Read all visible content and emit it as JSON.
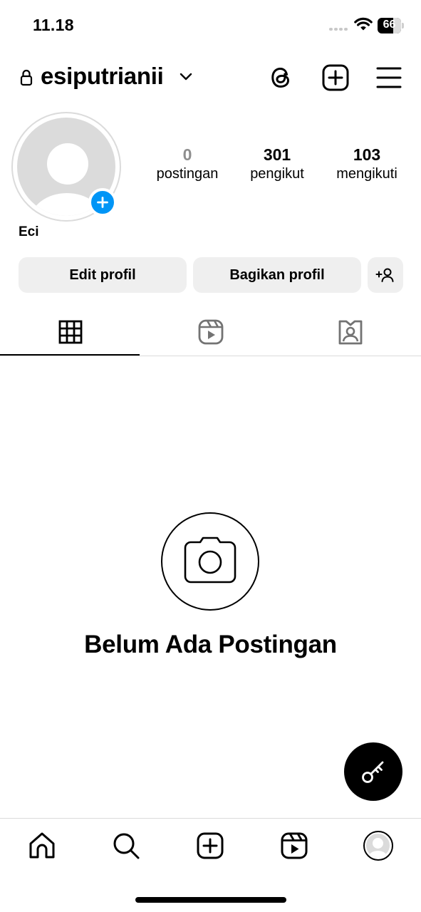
{
  "status_bar": {
    "time": "11.18",
    "battery_level": "66",
    "battery_percent": 66
  },
  "header": {
    "username": "esiputrianii",
    "icons": [
      "lock-icon",
      "chevron-down-icon",
      "threads-icon",
      "create-post-icon",
      "menu-icon"
    ]
  },
  "profile": {
    "display_name": "Eci",
    "stats": [
      {
        "value": "0",
        "label": "postingan"
      },
      {
        "value": "301",
        "label": "pengikut"
      },
      {
        "value": "103",
        "label": "mengikuti"
      }
    ],
    "buttons": {
      "edit": "Edit profil",
      "share": "Bagikan profil"
    }
  },
  "tabs": [
    "grid-icon",
    "reels-icon",
    "tagged-icon"
  ],
  "empty_state": {
    "title": "Belum Ada Postingan"
  },
  "bottom_nav": [
    "home-icon",
    "search-icon",
    "create-icon",
    "reels-icon",
    "profile-avatar"
  ],
  "colors": {
    "accent_blue": "#0095f6",
    "button_bg": "#efefef",
    "divider": "#dbdbdb",
    "zero_stat": "#8e8e8e"
  }
}
